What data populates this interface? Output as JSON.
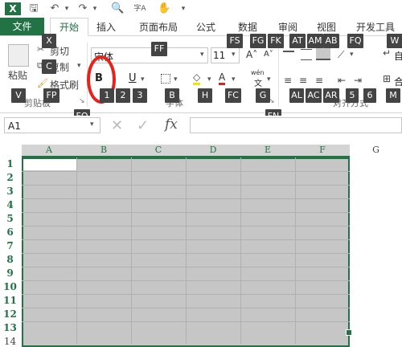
{
  "qat": {
    "save_icon": "save-icon",
    "undo_icon": "undo-icon",
    "redo_icon": "redo-icon"
  },
  "tabs": [
    {
      "label": "文件"
    },
    {
      "label": "开始"
    },
    {
      "label": "插入"
    },
    {
      "label": "页面布局"
    },
    {
      "label": "公式"
    },
    {
      "label": "数据"
    },
    {
      "label": "审阅"
    },
    {
      "label": "视图"
    },
    {
      "label": "开发工具"
    }
  ],
  "ribbon": {
    "paste": "粘贴",
    "cut": "剪切",
    "copy": "复制",
    "format_painter": "格式刷",
    "clipboard_group": "剪贴板",
    "font_name": "宋体",
    "font_size": "11",
    "font_group": "字体",
    "align_group": "对齐方式",
    "bold": "B",
    "italic": "I",
    "underline": "U",
    "wen": "wén"
  },
  "keytips": [
    "FF",
    "FS",
    "FG",
    "FK",
    "AT",
    "AM",
    "AB",
    "FQ",
    "W",
    "X",
    "C",
    "FP",
    "V",
    "1",
    "2",
    "3",
    "B",
    "H",
    "FC",
    "G",
    "AL",
    "AC",
    "AR",
    "5",
    "6",
    "M",
    "FO",
    "FN"
  ],
  "name_box": "A1",
  "fx": "fx",
  "columns": [
    "A",
    "B",
    "C",
    "D",
    "E",
    "F",
    "G"
  ],
  "rows": [
    "1",
    "2",
    "3",
    "4",
    "5",
    "6",
    "7",
    "8",
    "9",
    "10",
    "11",
    "12",
    "13",
    "14"
  ],
  "colors": {
    "accent": "#217346",
    "selection": "#c6c6c6",
    "keytip": "#444444",
    "highlight_circle": "#e8211a"
  }
}
